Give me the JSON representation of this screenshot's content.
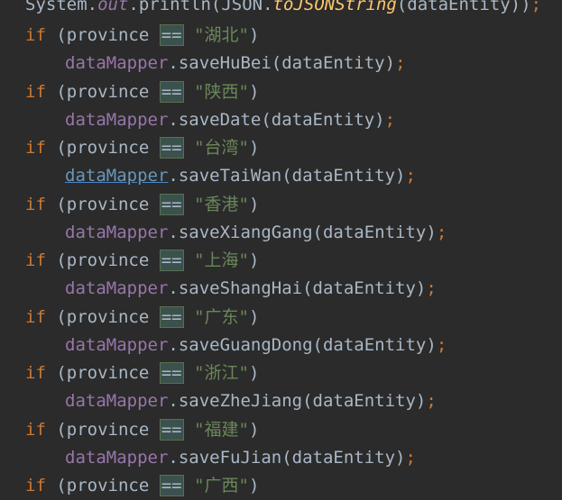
{
  "editor": {
    "line0": {
      "prefix": "System.",
      "out": "out",
      "println": ".println(JSON.",
      "toJSONString": "toJSONString",
      "args": "(dataEntity))",
      "semicolon": ";"
    },
    "blocks": [
      {
        "if": "if",
        "open": " (province ",
        "eq": "==",
        "str": " \"湖北\"",
        "close": ")",
        "obj": "dataMapper",
        "call": ".saveHuBei(dataEntity)",
        "semi": ";"
      },
      {
        "if": "if",
        "open": " (province ",
        "eq": "==",
        "str": " \"陕西\"",
        "close": ")",
        "obj": "dataMapper",
        "call": ".saveDate(dataEntity)",
        "semi": ";"
      },
      {
        "if": "if",
        "open": " (province ",
        "eq": "==",
        "str": " \"台湾\"",
        "close": ")",
        "obj": "dataMapper",
        "call": ".saveTaiWan(dataEntity)",
        "semi": ";"
      },
      {
        "if": "if",
        "open": " (province ",
        "eq": "==",
        "str": " \"香港\"",
        "close": ")",
        "obj": "dataMapper",
        "call": ".saveXiangGang(dataEntity)",
        "semi": ";"
      },
      {
        "if": "if",
        "open": " (province ",
        "eq": "==",
        "str": " \"上海\"",
        "close": ")",
        "obj": "dataMapper",
        "call": ".saveShangHai(dataEntity)",
        "semi": ";"
      },
      {
        "if": "if",
        "open": " (province ",
        "eq": "==",
        "str": " \"广东\"",
        "close": ")",
        "obj": "dataMapper",
        "call": ".saveGuangDong(dataEntity)",
        "semi": ";"
      },
      {
        "if": "if",
        "open": " (province ",
        "eq": "==",
        "str": " \"浙江\"",
        "close": ")",
        "obj": "dataMapper",
        "call": ".saveZheJiang(dataEntity)",
        "semi": ";"
      },
      {
        "if": "if",
        "open": " (province ",
        "eq": "==",
        "str": " \"福建\"",
        "close": ")",
        "obj": "dataMapper",
        "call": ".saveFuJian(dataEntity)",
        "semi": ";"
      }
    ],
    "last": {
      "if": "if",
      "open": " (province ",
      "eq": "==",
      "str": " \"广西\"",
      "close": ")"
    }
  },
  "colors": {
    "background": "#2b2b2b",
    "keyword": "#cc7832",
    "field": "#9876aa",
    "string": "#6a8759",
    "text": "#a9b7c6"
  }
}
